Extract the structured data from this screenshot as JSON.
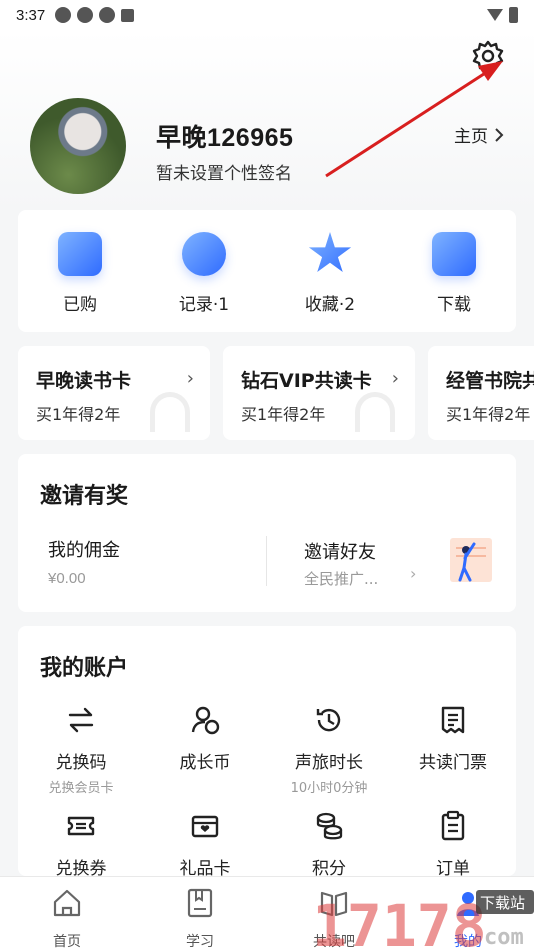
{
  "status_bar": {
    "time": "3:37"
  },
  "profile": {
    "username": "早晚126965",
    "signature": "暂未设置个性签名",
    "homepage_label": "主页"
  },
  "quick_actions": [
    {
      "label": "已购",
      "icon": "shopping-bag-icon"
    },
    {
      "label": "记录·1",
      "icon": "clock-icon"
    },
    {
      "label": "收藏·2",
      "icon": "star-icon"
    },
    {
      "label": "下载",
      "icon": "download-icon"
    }
  ],
  "member_cards": [
    {
      "title": "早晚读书卡",
      "subtitle": "买1年得2年"
    },
    {
      "title": "钻石VIP共读卡",
      "subtitle": "买1年得2年"
    },
    {
      "title": "经管书院共",
      "subtitle": "买1年得2年"
    }
  ],
  "invite": {
    "title": "邀请有奖",
    "commission_label": "我的佣金",
    "commission_value": "¥0.00",
    "invite_label": "邀请好友",
    "invite_sub": "全民推广..."
  },
  "account": {
    "title": "我的账户",
    "items": [
      {
        "label": "兑换码",
        "sub": "兑换会员卡",
        "icon": "exchange-icon"
      },
      {
        "label": "成长币",
        "sub": "",
        "icon": "coin-user-icon"
      },
      {
        "label": "声旅时长",
        "sub": "10小时0分钟",
        "icon": "history-clock-icon"
      },
      {
        "label": "共读门票",
        "sub": "",
        "icon": "receipt-icon"
      },
      {
        "label": "兑换券",
        "sub": "",
        "icon": "ticket-icon"
      },
      {
        "label": "礼品卡",
        "sub": "",
        "icon": "gift-card-icon"
      },
      {
        "label": "积分",
        "sub": "",
        "icon": "coins-stack-icon"
      },
      {
        "label": "订单",
        "sub": "",
        "icon": "clipboard-icon"
      }
    ]
  },
  "bottom_nav": [
    {
      "label": "首页",
      "icon": "home-icon"
    },
    {
      "label": "学习",
      "icon": "book-icon"
    },
    {
      "label": "共读吧",
      "icon": "group-read-icon"
    },
    {
      "label": "我的",
      "icon": "profile-icon"
    }
  ],
  "watermark": {
    "text": "下载站",
    "number": "17178",
    "domain": "com"
  },
  "colors": {
    "accent": "#2f6bff",
    "arrow": "#d81f1f"
  }
}
